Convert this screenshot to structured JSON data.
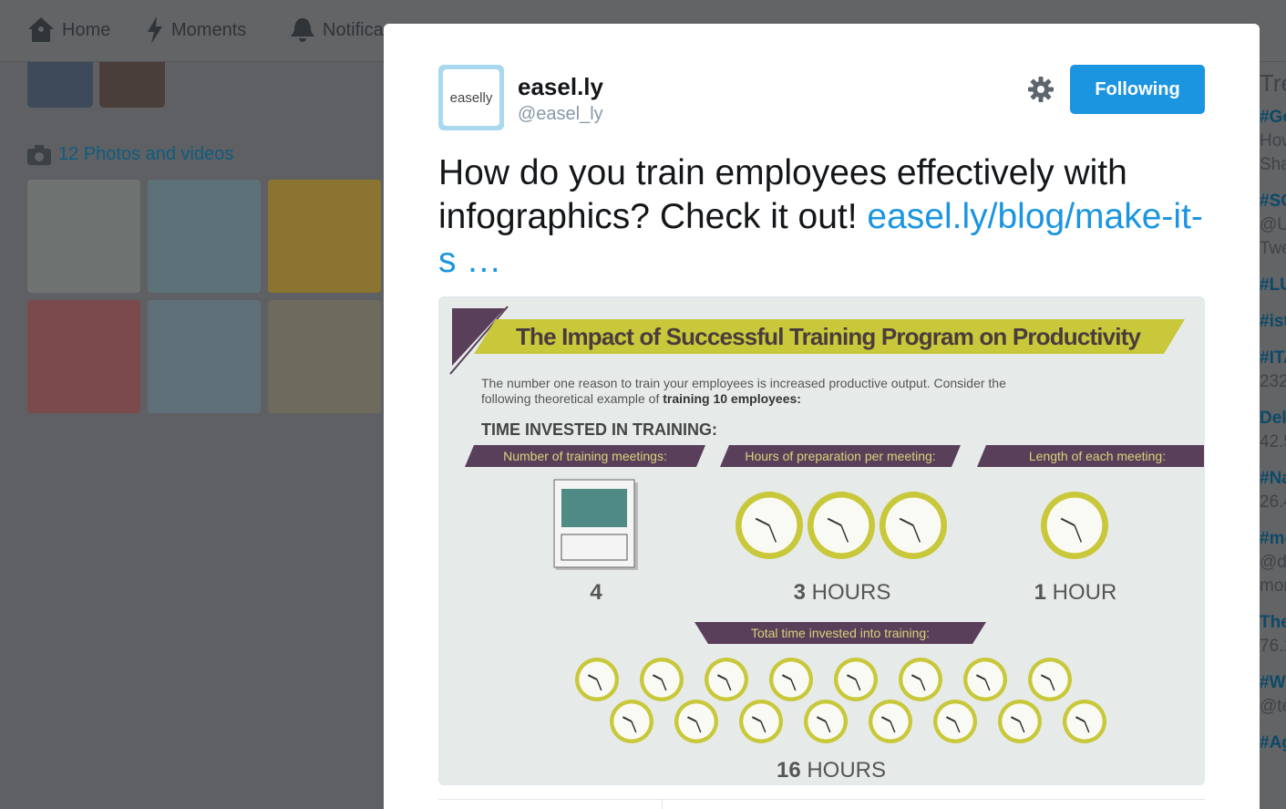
{
  "nav": {
    "items": [
      {
        "label": "Home",
        "icon": "home-icon"
      },
      {
        "label": "Moments",
        "icon": "lightning-icon"
      },
      {
        "label": "Notifica",
        "icon": "bell-icon"
      }
    ]
  },
  "profile": {
    "photos_label": "12 Photos and videos"
  },
  "trends": {
    "title": "Tre",
    "items": [
      {
        "tag": "#Go",
        "sub": [
          "How",
          "Sha"
        ]
      },
      {
        "tag": "#SC",
        "sub": [
          "@U",
          "Twe"
        ]
      },
      {
        "tag": "#LU",
        "sub": []
      },
      {
        "tag": "#ist",
        "sub": []
      },
      {
        "tag": "#ITA",
        "sub": [
          "232"
        ]
      },
      {
        "tag": "Del",
        "sub": [
          "42.5"
        ]
      },
      {
        "tag": "#Na",
        "sub": [
          "26.4"
        ]
      },
      {
        "tag": "#mo",
        "sub": [
          "@d",
          "mor"
        ]
      },
      {
        "tag": "The",
        "sub": [
          "76.1"
        ]
      },
      {
        "tag": "#W",
        "sub": [
          "@te"
        ]
      },
      {
        "tag": "#Ag",
        "sub": []
      }
    ]
  },
  "tweet": {
    "logo_text": "easelly",
    "name": "easel.ly",
    "handle": "@easel_ly",
    "follow_label": "Following",
    "text": "How do you train employees effectively with infographics? Check it out! ",
    "link": "easel.ly/blog/make-it-s …",
    "colors": {
      "accent": "#1b95e0",
      "infographic_purple": "#5a3f5a",
      "infographic_yellow": "#c8c83a"
    },
    "infographic": {
      "title": "The Impact of Successful Training Program on Productivity",
      "intro": "The number one reason to train your employees is increased productive output. Consider the",
      "intro2_prefix": "following theoretical example of ",
      "intro2_bold": "training 10 employees:",
      "section": "TIME INVESTED IN TRAINING:",
      "labels": [
        "Number of training meetings:",
        "Hours of preparation per meeting:",
        "Length of each meeting:"
      ],
      "values": [
        {
          "num": "4",
          "unit": ""
        },
        {
          "num": "3",
          "unit": " HOURS"
        },
        {
          "num": "1",
          "unit": " HOUR"
        }
      ],
      "total_label": "Total time invested into training:",
      "total": {
        "num": "16",
        "unit": " HOURS"
      }
    }
  }
}
